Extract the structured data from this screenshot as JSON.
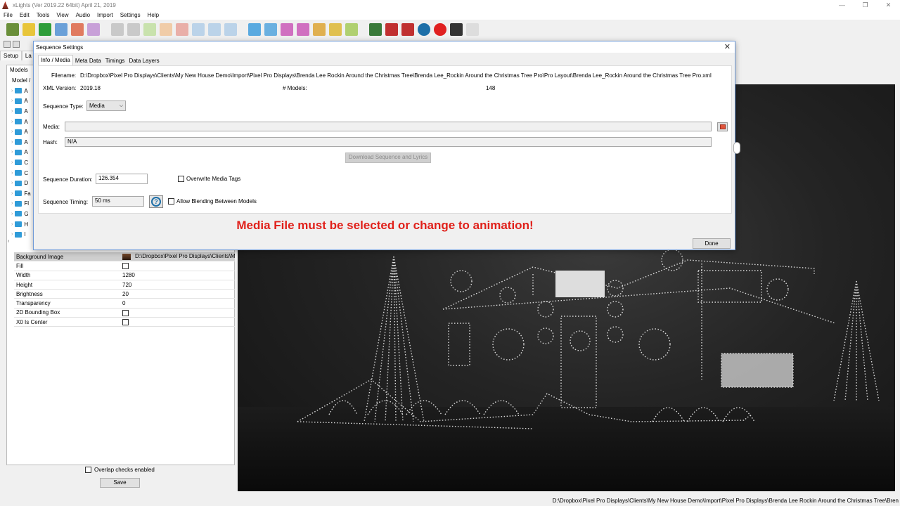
{
  "window": {
    "title": "xLights (Ver 2019.22 64bit) April 21, 2019",
    "min": "—",
    "max": "❐",
    "close": "✕"
  },
  "menu": [
    "File",
    "Edit",
    "Tools",
    "View",
    "Audio",
    "Import",
    "Settings",
    "Help"
  ],
  "tabs": {
    "setup": "Setup",
    "layout": "La"
  },
  "left": {
    "models_tab": "Models",
    "tree_header": "Model /",
    "tree_items": [
      "A",
      "A",
      "A",
      "A",
      "A",
      "A",
      "A",
      "C",
      "C",
      "D",
      "Fa",
      "Fl",
      "G",
      "H",
      "I"
    ],
    "properties": [
      {
        "key": "Background Image",
        "value": "D:\\Dropbox\\Pixel Pro Displays\\Clients\\M",
        "type": "image"
      },
      {
        "key": "Fill",
        "value": "",
        "type": "checkbox"
      },
      {
        "key": "Width",
        "value": "1280",
        "type": "text"
      },
      {
        "key": "Height",
        "value": "720",
        "type": "text"
      },
      {
        "key": "Brightness",
        "value": "20",
        "type": "text"
      },
      {
        "key": "Transparency",
        "value": "0",
        "type": "text"
      },
      {
        "key": "2D Bounding Box",
        "value": "",
        "type": "checkbox"
      },
      {
        "key": "X0 Is Center",
        "value": "",
        "type": "checkbox"
      }
    ],
    "overlap_label": "Overlap checks enabled",
    "save_label": "Save"
  },
  "dialog": {
    "title": "Sequence Settings",
    "close": "✕",
    "tabs": [
      "Info / Media",
      "Meta Data",
      "Timings",
      "Data Layers"
    ],
    "filename_label": "Filename:",
    "filename_value": "D:\\Dropbox\\Pixel Pro Displays\\Clients\\My New House Demo\\Import\\Pixel Pro Displays\\Brenda Lee Rockin Around the Christmas Tree\\Brenda Lee_Rockin Around the Christmas Tree Pro\\Pro Layout\\Brenda Lee_Rockin Around the Christmas Tree Pro.xml",
    "xml_version_label": "XML Version:",
    "xml_version_value": "2019.18",
    "models_label": "# Models:",
    "models_value": "148",
    "sequence_type_label": "Sequence Type:",
    "sequence_type_value": "Media",
    "media_label": "Media:",
    "media_value": "",
    "hash_label": "Hash:",
    "hash_value": "N/A",
    "download_label": "Download Sequence and Lyrics",
    "duration_label": "Sequence Duration:",
    "duration_value": "126.354",
    "overwrite_label": "Overwrite Media Tags",
    "timing_label": "Sequence Timing:",
    "timing_value": "50 ms",
    "help_glyph": "?",
    "blending_label": "Allow Blending Between Models",
    "warning": "Media File must be selected or change to animation!",
    "done_label": "Done"
  },
  "status_path": "D:\\Dropbox\\Pixel Pro Displays\\Clients\\My New House Demo\\Import\\Pixel Pro Displays\\Brenda Lee Rockin Around the Christmas Tree\\Bren",
  "toolbar_colors": [
    "#6a8f3a",
    "#e8c53a",
    "#2e9d3a",
    "#6aa0d8",
    "#e07a5f",
    "#c8a0d8",
    "#9a9a9a",
    "#9a9a9a",
    "#9ad05a",
    "#f0a050",
    "#e06050",
    "#7ab0e0",
    "#7ab0e0",
    "#7ab0e0",
    "#5aaae0",
    "#6ab0e0",
    "#d070c0",
    "#d070c0",
    "#e0b050",
    "#e0c050",
    "#b0d070",
    "#3a7a3a",
    "#c03030",
    "#c03030",
    "#1d6fa8",
    "#e02020",
    "#333333",
    "#dddddd"
  ]
}
